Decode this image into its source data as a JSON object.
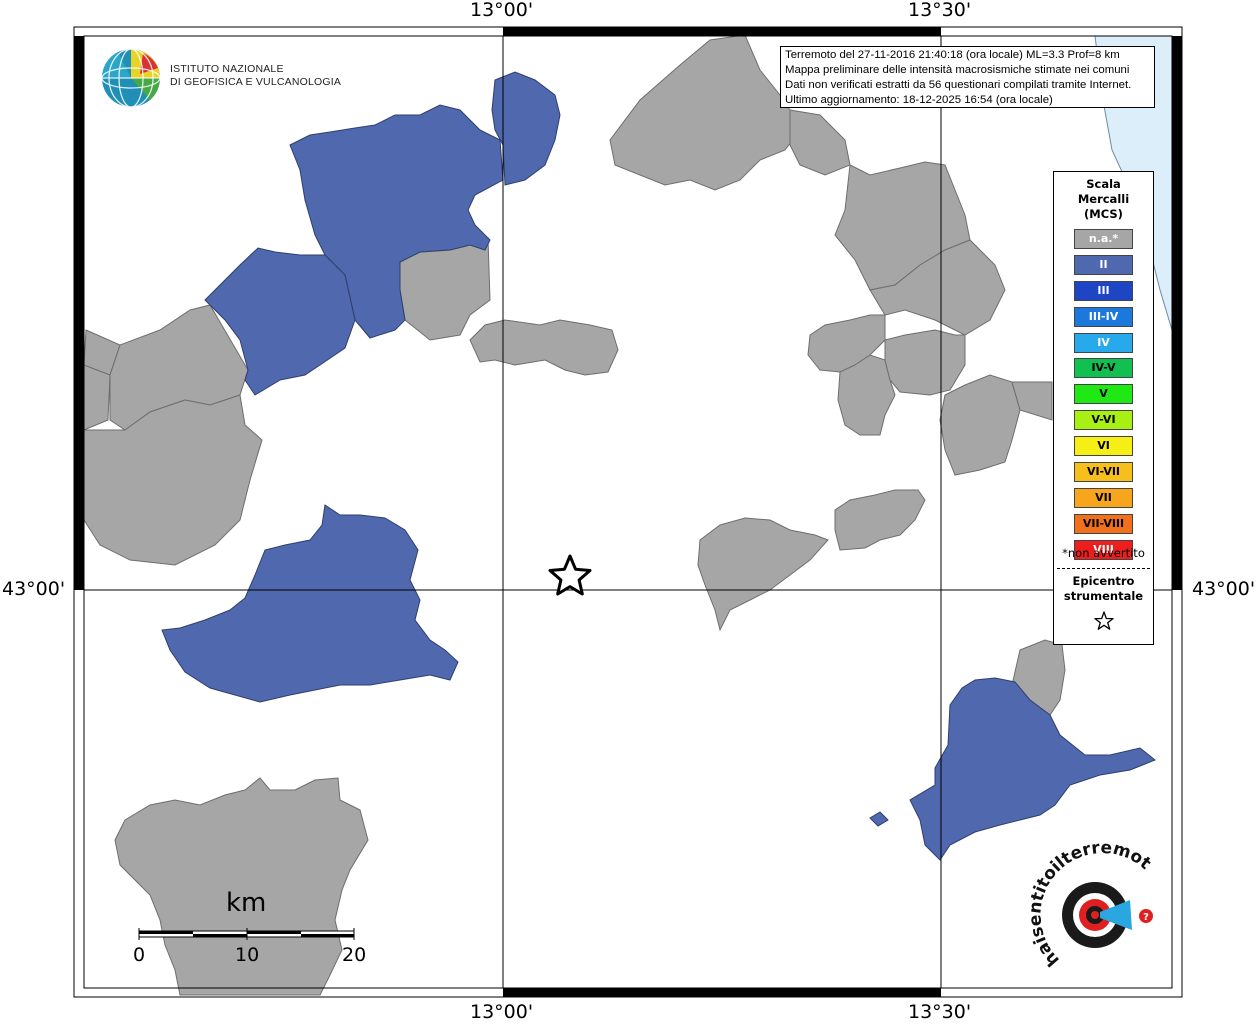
{
  "coords": {
    "lon_left": "13°00'",
    "lon_right": "13°30'",
    "lat": "43°00'"
  },
  "institute": {
    "line1": "ISTITUTO NAZIONALE",
    "line2": "DI GEOFISICA E VULCANOLOGIA"
  },
  "info": {
    "line1": "Terremoto del 27-11-2016 21:40:18 (ora locale) ML=3.3 Prof=8 km",
    "line2": "Mappa preliminare delle intensità macrosismiche stimate nei comuni",
    "line3": "Dati non verificati estratti da 56 questionari compilati tramite Internet.",
    "line4": "Ultimo aggiornamento: 18-12-2025 16:54 (ora locale)"
  },
  "legend": {
    "title1": "Scala",
    "title2": "Mercalli",
    "title3": "(MCS)",
    "items": [
      {
        "label": "n.a.*",
        "color": "#a6a6a6",
        "dark": false
      },
      {
        "label": "II",
        "color": "#5068ad",
        "dark": false
      },
      {
        "label": "III",
        "color": "#1d45c4",
        "dark": false
      },
      {
        "label": "III-IV",
        "color": "#1c79db",
        "dark": false
      },
      {
        "label": "IV",
        "color": "#27a9ec",
        "dark": false
      },
      {
        "label": "IV-V",
        "color": "#11c050",
        "dark": true
      },
      {
        "label": "V",
        "color": "#1fe814",
        "dark": true
      },
      {
        "label": "V-VI",
        "color": "#a8ef13",
        "dark": true
      },
      {
        "label": "VI",
        "color": "#f6ef16",
        "dark": true
      },
      {
        "label": "VI-VII",
        "color": "#f6bf1c",
        "dark": true
      },
      {
        "label": "VII",
        "color": "#f6a51c",
        "dark": true
      },
      {
        "label": "VII-VIII",
        "color": "#f0701c",
        "dark": true
      },
      {
        "label": "VIII",
        "color": "#ee1e1e",
        "dark": false
      }
    ],
    "not_felt": "*non avvertito",
    "epicenter1": "Epicentro",
    "epicenter2": "strumentale"
  },
  "scale": {
    "unit": "km",
    "ticks": [
      "0",
      "10",
      "20"
    ]
  },
  "colors": {
    "intensity_na": "#a6a6a6",
    "intensity_II": "#5068ad",
    "sea": "#dbeefa"
  },
  "logo_text": "haisentitoilterremoto.it"
}
